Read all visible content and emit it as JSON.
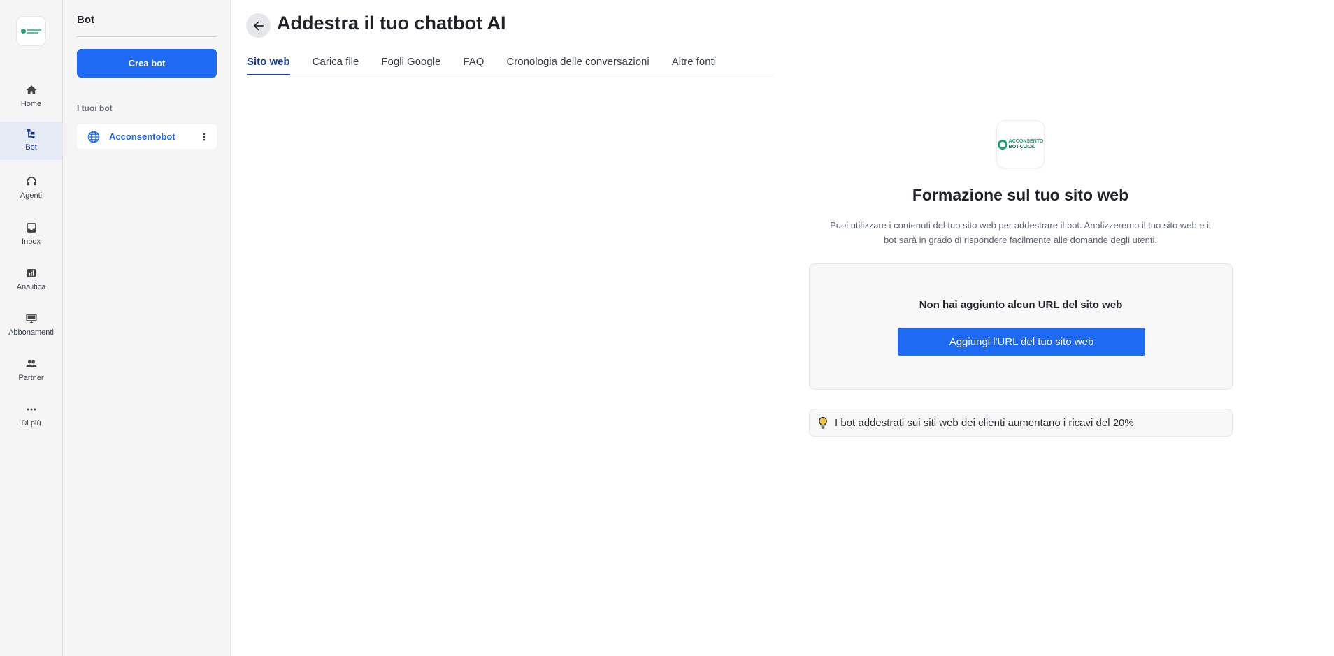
{
  "rail": {
    "items": [
      {
        "label": "Home",
        "icon": "home-icon"
      },
      {
        "label": "Bot",
        "icon": "bot-icon"
      },
      {
        "label": "Agenti",
        "icon": "headset-icon"
      },
      {
        "label": "Inbox",
        "icon": "inbox-icon"
      },
      {
        "label": "Analitica",
        "icon": "chart-icon"
      },
      {
        "label": "Abbonamenti",
        "icon": "monitor-icon"
      },
      {
        "label": "Partner",
        "icon": "people-icon"
      },
      {
        "label": "Di più",
        "icon": "more-horizontal-icon"
      }
    ],
    "active": "Bot"
  },
  "sidebar": {
    "title": "Bot",
    "create_label": "Crea bot",
    "section_label": "I tuoi bot",
    "bots": [
      {
        "name": "Acconsentobot",
        "icon": "globe-icon"
      }
    ]
  },
  "header": {
    "title": "Addestra il tuo chatbot AI"
  },
  "tabs": [
    {
      "label": "Sito web",
      "active": true
    },
    {
      "label": "Carica file",
      "active": false
    },
    {
      "label": "Fogli Google",
      "active": false
    },
    {
      "label": "FAQ",
      "active": false
    },
    {
      "label": "Cronologia delle conversazioni",
      "active": false
    },
    {
      "label": "Altre fonti",
      "active": false
    }
  ],
  "panel": {
    "title": "Formazione sul tuo sito web",
    "description": "Puoi utilizzare i contenuti del tuo sito web per addestrare il bot. Analizzeremo il tuo sito web e il bot sarà in grado di rispondere facilmente alle domande degli utenti.",
    "empty_text": "Non hai aggiunto alcun URL del sito web",
    "add_url_label": "Aggiungi l'URL del tuo sito web",
    "tip": "I bot addestrati sui siti web dei clienti aumentano i ricavi del 20%"
  },
  "colors": {
    "accent": "#1f6af2",
    "active_tab": "#1a3d8f",
    "brand_green": "#1aa37a"
  }
}
